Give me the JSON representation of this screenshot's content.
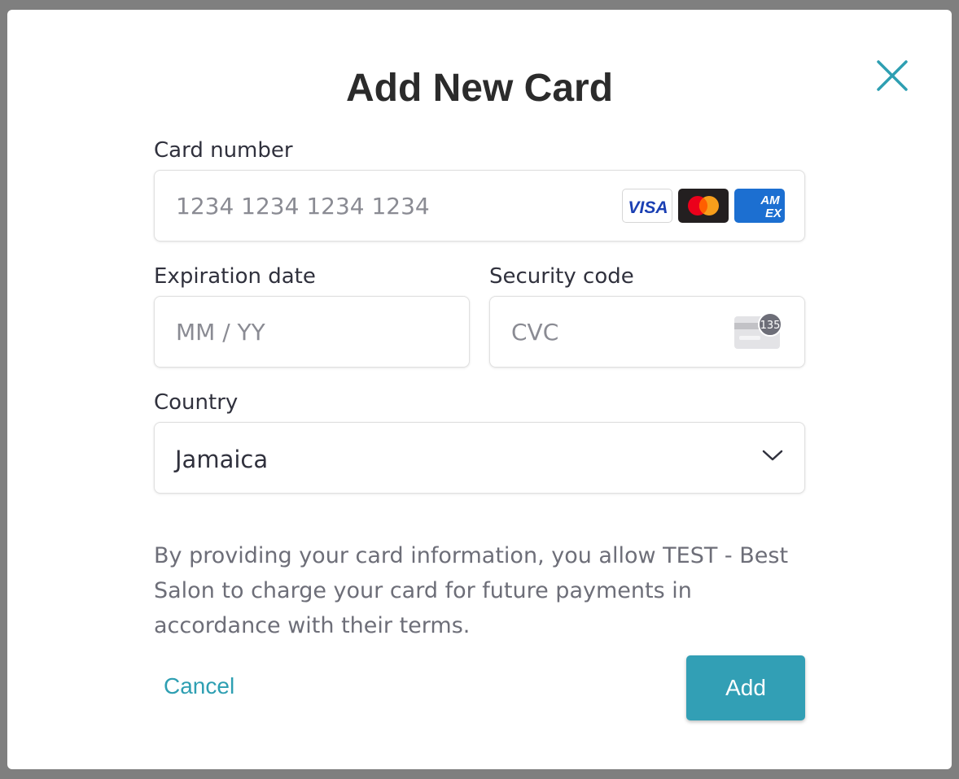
{
  "modal": {
    "title": "Add New Card",
    "close_icon": "close-icon"
  },
  "card_number": {
    "label": "Card number",
    "placeholder": "1234 1234 1234 1234",
    "brands": [
      {
        "name": "VISA",
        "icon": "visa-icon",
        "color": "#1a1f71"
      },
      {
        "name": "Mastercard",
        "icon": "mastercard-icon",
        "color": "#231f20"
      },
      {
        "name": "AMEX",
        "icon": "amex-icon",
        "color": "#006fcf"
      }
    ]
  },
  "expiration": {
    "label": "Expiration date",
    "placeholder": "MM / YY"
  },
  "security_code": {
    "label": "Security code",
    "placeholder": "CVC",
    "icon": "cvc-card-icon",
    "icon_badge": "135"
  },
  "country": {
    "label": "Country",
    "selected": "Jamaica",
    "icon": "chevron-down-icon"
  },
  "disclaimer": "By providing your card information, you allow TEST - Best Salon to charge your card for future payments in accordance with their terms.",
  "actions": {
    "cancel_label": "Cancel",
    "add_label": "Add"
  },
  "colors": {
    "accent": "#2e9fb2",
    "primary_button": "#329fb5",
    "overlay": "#7f7f7f"
  }
}
